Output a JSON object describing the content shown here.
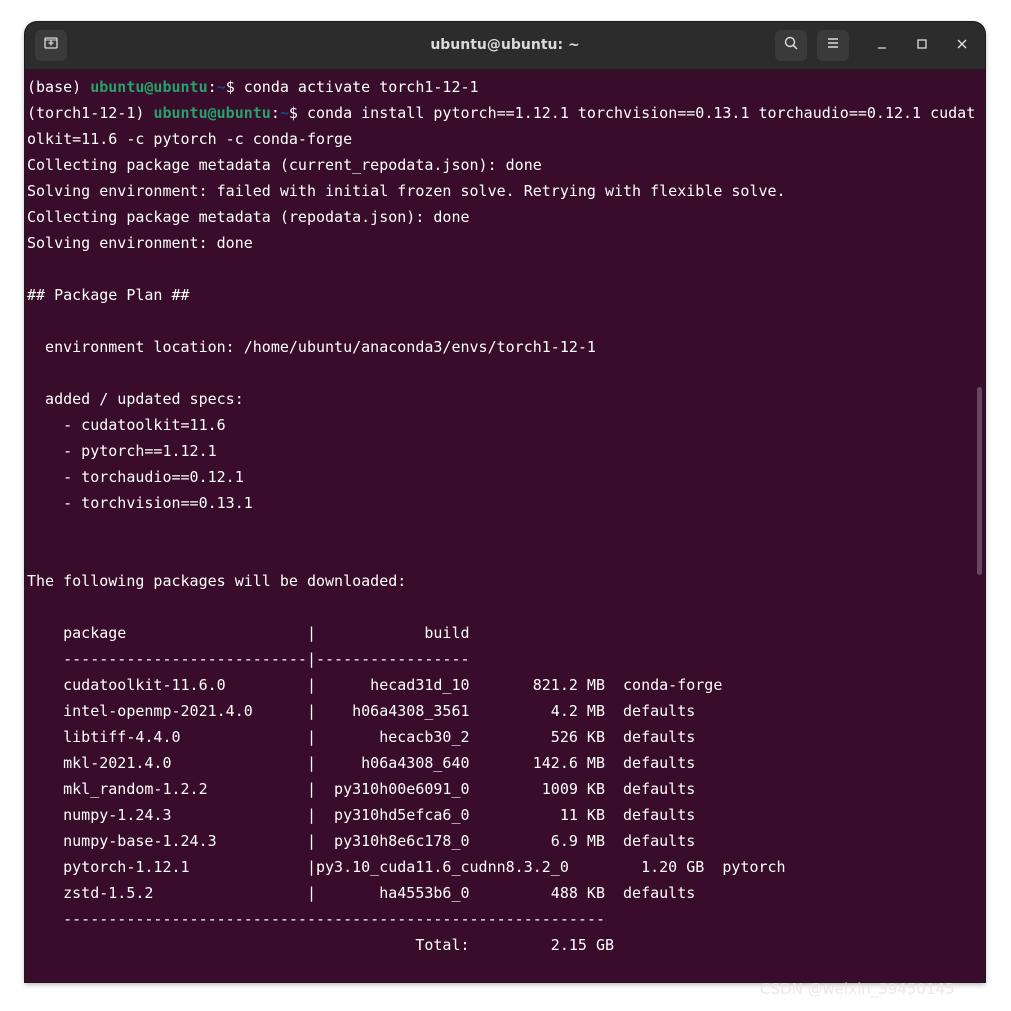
{
  "window": {
    "title": "ubuntu@ubuntu: ~"
  },
  "titlebar": {
    "icons": {
      "new_tab": "new-tab-icon",
      "search": "search-icon",
      "menu": "hamburger-menu-icon",
      "minimize": "minimize-icon",
      "maximize": "maximize-icon",
      "close": "close-icon"
    }
  },
  "colors": {
    "terminal_bg": "#380c2a",
    "titlebar_bg": "#2c2c2c",
    "prompt_user": "#26a269",
    "prompt_path": "#12488b",
    "text": "#ffffff"
  },
  "terminal": {
    "prompt1": {
      "env": "(base) ",
      "user": "ubuntu@ubuntu",
      "colon": ":",
      "path": "~",
      "dollar": "$ ",
      "command": "conda activate torch1-12-1"
    },
    "prompt2": {
      "env": "(torch1-12-1) ",
      "user": "ubuntu@ubuntu",
      "colon": ":",
      "path": "~",
      "dollar": "$ ",
      "command": "conda install pytorch==1.12.1 torchvision==0.13.1 torchaudio==0.12.1 cudat"
    },
    "output": [
      "olkit=11.6 -c pytorch -c conda-forge",
      "Collecting package metadata (current_repodata.json): done",
      "Solving environment: failed with initial frozen solve. Retrying with flexible solve.",
      "Collecting package metadata (repodata.json): done",
      "Solving environment: done",
      "",
      "## Package Plan ##",
      "",
      "  environment location: /home/ubuntu/anaconda3/envs/torch1-12-1",
      "",
      "  added / updated specs:",
      "    - cudatoolkit=11.6",
      "    - pytorch==1.12.1",
      "    - torchaudio==0.12.1",
      "    - torchvision==0.13.1",
      "",
      "",
      "The following packages will be downloaded:",
      "",
      "    package                    |            build",
      "    ---------------------------|-----------------",
      "    cudatoolkit-11.6.0         |      hecad31d_10       821.2 MB  conda-forge",
      "    intel-openmp-2021.4.0      |    h06a4308_3561         4.2 MB  defaults",
      "    libtiff-4.4.0              |       hecacb30_2         526 KB  defaults",
      "    mkl-2021.4.0               |     h06a4308_640       142.6 MB  defaults",
      "    mkl_random-1.2.2           |  py310h00e6091_0        1009 KB  defaults",
      "    numpy-1.24.3               |  py310hd5efca6_0          11 KB  defaults",
      "    numpy-base-1.24.3          |  py310h8e6c178_0         6.9 MB  defaults",
      "    pytorch-1.12.1             |py3.10_cuda11.6_cudnn8.3.2_0        1.20 GB  pytorch",
      "    zstd-1.5.2                 |       ha4553b6_0         488 KB  defaults",
      "    ------------------------------------------------------------",
      "                                           Total:         2.15 GB"
    ]
  },
  "watermark": "CSDN @weixin_39450145"
}
